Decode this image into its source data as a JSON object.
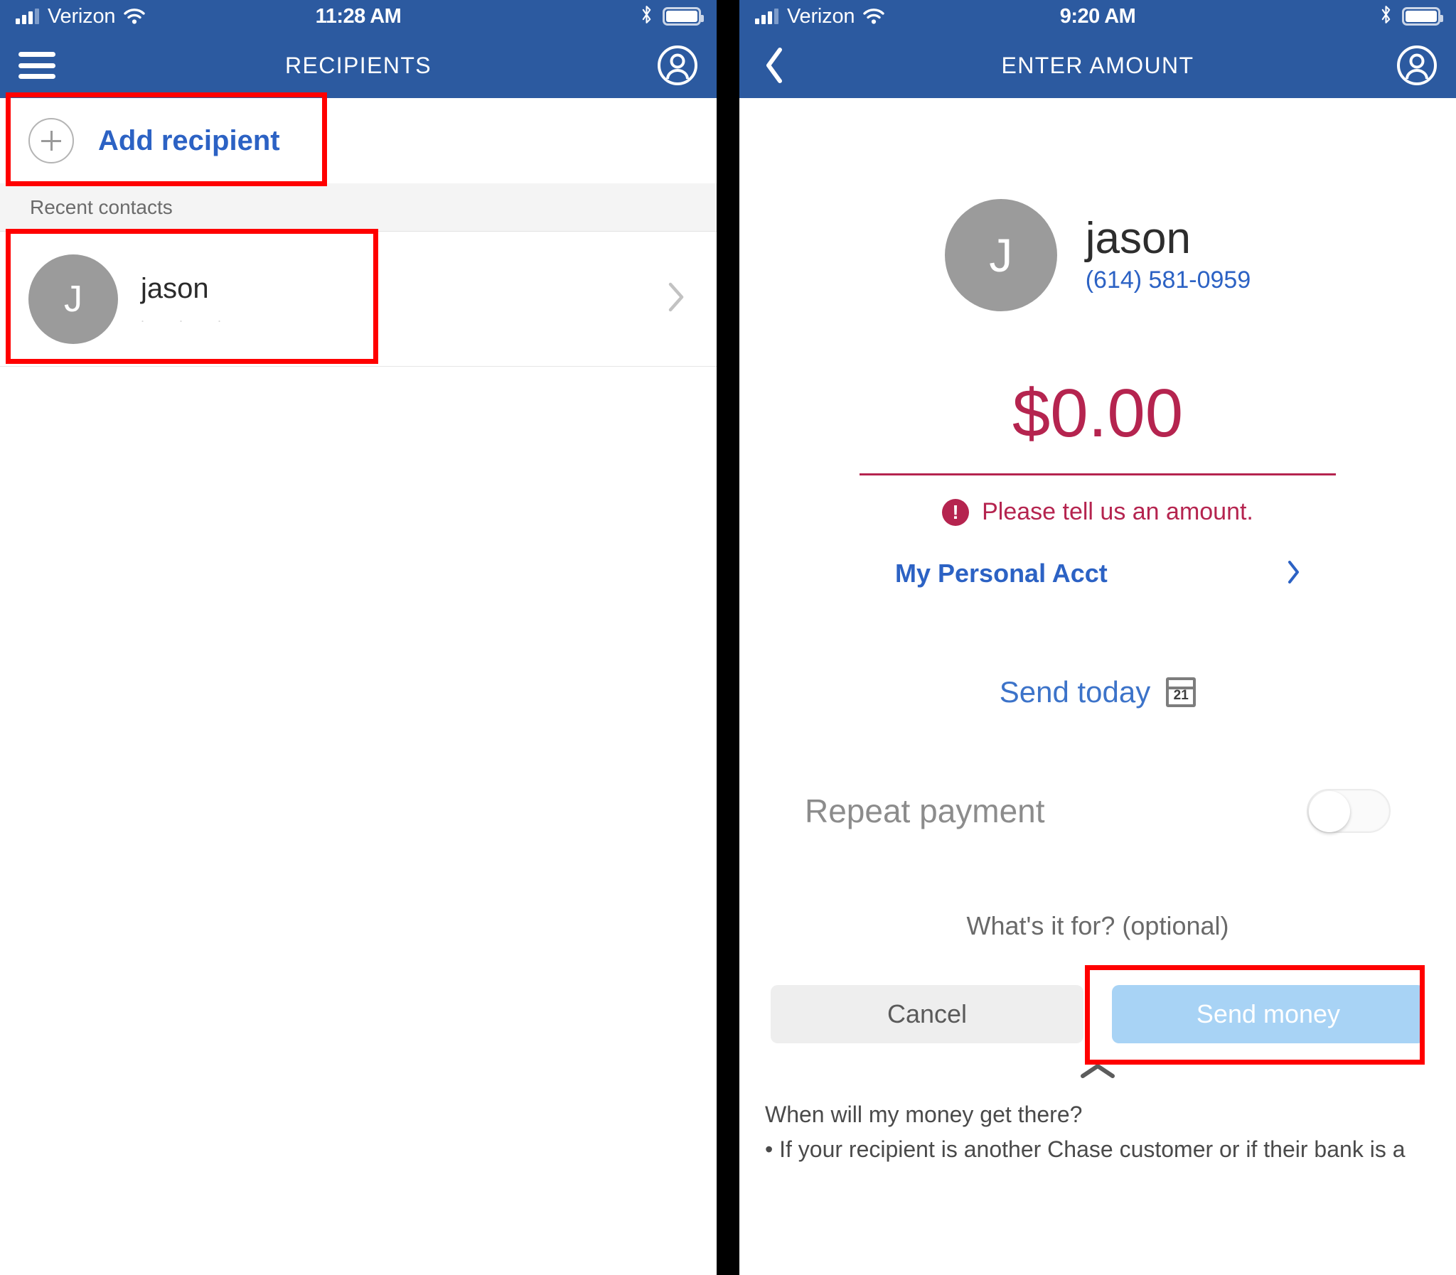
{
  "left_screen": {
    "status_bar": {
      "carrier": "Verizon",
      "time": "11:28 AM",
      "signal_icon": "cellular-signal-icon",
      "wifi_icon": "wifi-icon",
      "bluetooth_icon": "bluetooth-icon",
      "battery_icon": "battery-full-icon"
    },
    "nav": {
      "menu_icon": "hamburger-menu-icon",
      "title": "RECIPIENTS",
      "profile_icon": "user-profile-icon"
    },
    "add_recipient": {
      "label": "Add recipient",
      "icon": "plus-circle-icon"
    },
    "section_header": "Recent contacts",
    "contacts": [
      {
        "initial": "J",
        "name": "jason",
        "subtitle": ".                .        .",
        "chevron_icon": "chevron-right-icon"
      }
    ]
  },
  "right_screen": {
    "status_bar": {
      "carrier": "Verizon",
      "time": "9:20 AM",
      "signal_icon": "cellular-signal-icon",
      "wifi_icon": "wifi-icon",
      "bluetooth_icon": "bluetooth-icon",
      "battery_icon": "battery-full-icon"
    },
    "nav": {
      "back_icon": "chevron-left-icon",
      "title": "ENTER AMOUNT",
      "profile_icon": "user-profile-icon"
    },
    "payee": {
      "initial": "J",
      "name": "jason",
      "phone": "(614) 581-0959"
    },
    "amount": {
      "value": "$0.00",
      "error_icon": "exclamation-circle-icon",
      "error_text": "Please tell us an amount."
    },
    "account": {
      "label": "My Personal Acct",
      "chevron_icon": "chevron-right-icon"
    },
    "schedule": {
      "label": "Send today",
      "calendar_icon": "calendar-icon",
      "calendar_day": "21"
    },
    "repeat": {
      "label": "Repeat payment",
      "toggle_state": "off"
    },
    "memo_placeholder": "What's it for? (optional)",
    "buttons": {
      "cancel": "Cancel",
      "send": "Send money"
    },
    "expander_icon": "chevron-up-icon",
    "footer": {
      "question": "When will my money get there?",
      "bullet": "• If your recipient is another Chase customer or if their bank is a"
    }
  },
  "colors": {
    "nav_blue": "#2c5aa0",
    "link_blue": "#2c62c4",
    "error_crimson": "#b5244f",
    "annotation_red": "#ff0000",
    "avatar_gray": "#9b9b9b",
    "send_button_blue": "#a8d3f5"
  }
}
